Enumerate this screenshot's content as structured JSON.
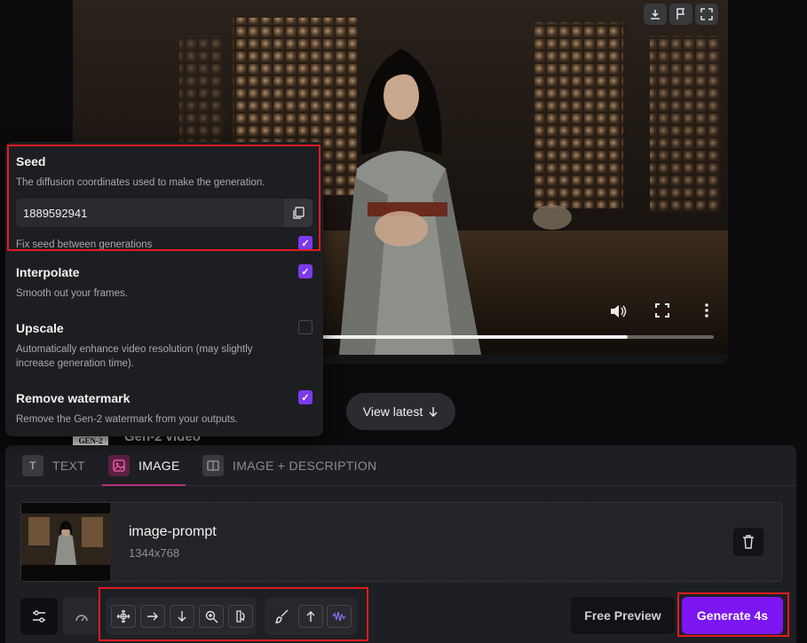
{
  "video": {
    "progress_fraction": 0.78,
    "icons": [
      "download-icon",
      "flag-icon",
      "expand-icon",
      "volume-icon",
      "fullscreen-icon",
      "more-vertical-icon"
    ]
  },
  "settings": {
    "seed": {
      "title": "Seed",
      "description": "The diffusion coordinates used to make the generation.",
      "value": "1889592941",
      "fix_label": "Fix seed between generations",
      "fix_checked": true
    },
    "interpolate": {
      "title": "Interpolate",
      "description": "Smooth out your frames.",
      "checked": true
    },
    "upscale": {
      "title": "Upscale",
      "description": "Automatically enhance video resolution (may slightly increase generation time).",
      "checked": false
    },
    "watermark": {
      "title": "Remove watermark",
      "description": "Remove the Gen-2 watermark from your outputs.",
      "checked": true
    }
  },
  "view_latest": "View latest",
  "gen2": {
    "logo": "GEN-2",
    "title": "Gen-2 video"
  },
  "tabs": [
    {
      "label": "TEXT",
      "icon": "T",
      "active": false
    },
    {
      "label": "IMAGE",
      "icon": "image-icon",
      "active": true
    },
    {
      "label": "IMAGE + DESCRIPTION",
      "icon": "image-text-icon",
      "active": false
    }
  ],
  "prompt": {
    "name": "image-prompt",
    "dims": "1344x768"
  },
  "toolbar": {
    "camera_tools": [
      "camera-pan-icon",
      "arrow-right-icon",
      "arrow-down-icon",
      "zoom-in-icon",
      "rotate-icon"
    ],
    "motion_tools": [
      "brush-icon",
      "arrow-up-icon",
      "waveform-icon"
    ],
    "free_preview": "Free Preview",
    "generate": "Generate 4s"
  },
  "colors": {
    "accent": "#7c16f2",
    "checkbox": "#7c3aed",
    "highlight": "#e01b22",
    "active_tab": "#b6317f"
  }
}
